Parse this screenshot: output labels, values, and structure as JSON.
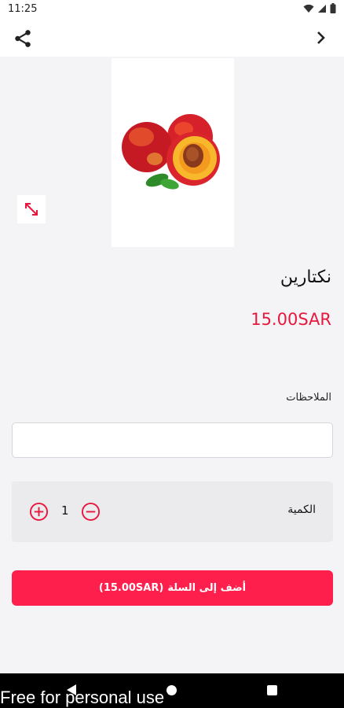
{
  "status_bar": {
    "time": "11:25",
    "icons": [
      "wifi-icon",
      "signal-icon",
      "battery-icon"
    ]
  },
  "app_bar": {
    "icons": [
      "share-icon",
      "chevron-right-icon"
    ]
  },
  "product": {
    "name": "نكتارين",
    "price": "15.00SAR",
    "image": "nectarine-fruit-image"
  },
  "notes": {
    "label": "الملاحظات",
    "value": "",
    "placeholder": ""
  },
  "quantity": {
    "label": "الكمية",
    "value": "1"
  },
  "cart_button": {
    "label": "أضف إلى السلة",
    "price": "(15.00SAR)"
  },
  "watermark": "Free for personal use",
  "colors": {
    "accent": "#fe1f4c",
    "price": "#e8173e",
    "background": "#f4f4f6"
  }
}
